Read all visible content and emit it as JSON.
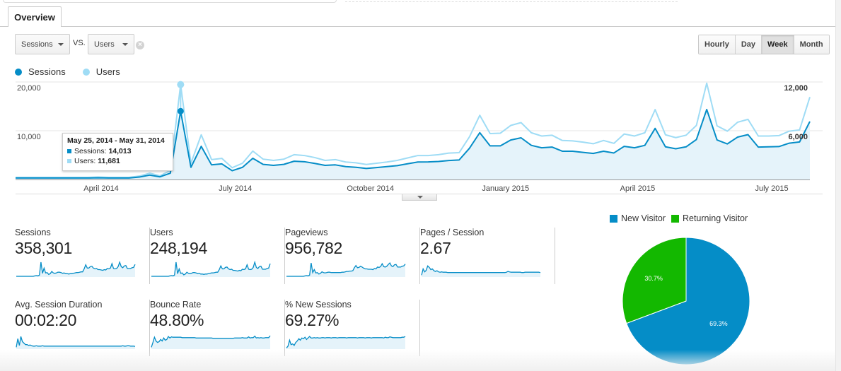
{
  "tabs": [
    {
      "label": "Overview",
      "active": true
    }
  ],
  "controls": {
    "primary_metric": "Sessions",
    "vs_label": "VS.",
    "secondary_metric": "Users",
    "clear_icon": "×",
    "periods": [
      {
        "label": "Hourly",
        "active": false
      },
      {
        "label": "Day",
        "active": false
      },
      {
        "label": "Week",
        "active": true
      },
      {
        "label": "Month",
        "active": false
      }
    ]
  },
  "colors": {
    "sessions": "#058dc7",
    "users": "#9fdcf5",
    "area_fill": "#e5f3fa",
    "new_visitor": "#058dc7",
    "returning_visitor": "#13b800"
  },
  "tooltip": {
    "title": "May 25, 2014 - May 31, 2014",
    "rows": [
      {
        "label": "Sessions: ",
        "value": "14,013"
      },
      {
        "label": "Users: ",
        "value": "11,681"
      }
    ],
    "hover_index": 16
  },
  "chart_data": [
    {
      "type": "line",
      "title": "",
      "granularity": "week",
      "legend": [
        "Sessions",
        "Users"
      ],
      "legend_position": "top-left",
      "x_tick_labels": [
        "April 2014",
        "July 2014",
        "October 2014",
        "January 2015",
        "April 2015",
        "July 2015"
      ],
      "x_tick_week_index": [
        8.3,
        21.3,
        34.4,
        47.5,
        60.3,
        73.3
      ],
      "left_axis": {
        "series": "Sessions",
        "ticks": [
          "20,000",
          "10,000"
        ],
        "range": [
          0,
          20000
        ]
      },
      "right_axis": {
        "series": "Users",
        "ticks": [
          "12,000",
          "6,000"
        ],
        "range": [
          0,
          12000
        ]
      },
      "grid": true,
      "series": [
        {
          "name": "Sessions",
          "axis": "left",
          "values": [
            300,
            300,
            300,
            300,
            300,
            300,
            300,
            300,
            350,
            300,
            300,
            300,
            500,
            900,
            550,
            1300,
            14013,
            2500,
            6800,
            3000,
            3200,
            1800,
            2500,
            4350,
            3100,
            2900,
            3100,
            3750,
            3650,
            3300,
            2900,
            3000,
            2650,
            2500,
            2270,
            2450,
            2650,
            2850,
            3230,
            3580,
            3600,
            3700,
            3900,
            4000,
            6400,
            9600,
            6900,
            6900,
            8100,
            8550,
            7000,
            6500,
            6650,
            5800,
            5800,
            5560,
            5350,
            5800,
            5440,
            6800,
            6500,
            7000,
            10480,
            6700,
            6300,
            6700,
            8200,
            14350,
            8100,
            7300,
            8700,
            9200,
            6650,
            6700,
            6750,
            7450,
            7700,
            11900
          ]
        },
        {
          "name": "Users",
          "axis": "right",
          "values": [
            260,
            260,
            260,
            260,
            260,
            260,
            260,
            260,
            300,
            260,
            260,
            260,
            420,
            780,
            450,
            1100,
            11681,
            2000,
            5500,
            2450,
            2600,
            1450,
            2000,
            3500,
            2500,
            2350,
            2500,
            3050,
            2950,
            2700,
            2350,
            2450,
            2150,
            2050,
            1850,
            2000,
            2150,
            2350,
            2650,
            2950,
            2950,
            3050,
            3250,
            3300,
            5250,
            7900,
            5650,
            5700,
            6650,
            7000,
            5750,
            5350,
            5450,
            4800,
            4750,
            4600,
            4400,
            4800,
            4450,
            5600,
            5350,
            5750,
            8600,
            5500,
            5150,
            5450,
            6650,
            11850,
            6600,
            5950,
            7050,
            7400,
            5350,
            5350,
            5400,
            5950,
            6100,
            10150
          ]
        }
      ]
    },
    {
      "type": "pie",
      "title": "",
      "legend": [
        "New Visitor",
        "Returning Visitor"
      ],
      "legend_position": "top",
      "values": [
        69.3,
        30.7
      ],
      "labels": [
        "69.3%",
        "30.7%"
      ]
    }
  ],
  "metrics": [
    {
      "label": "Sessions",
      "value": "358,301",
      "spark": [
        2,
        2,
        2,
        2,
        2,
        2,
        2,
        2,
        2,
        2,
        2,
        2,
        3,
        4,
        3,
        5,
        40,
        10,
        24,
        11,
        12,
        7,
        9,
        15,
        11,
        10,
        11,
        13,
        13,
        12,
        10,
        11,
        9,
        9,
        8,
        9,
        9,
        10,
        11,
        12,
        12,
        13,
        14,
        14,
        22,
        33,
        24,
        24,
        28,
        29,
        24,
        22,
        23,
        20,
        20,
        19,
        18,
        20,
        19,
        23,
        22,
        24,
        36,
        23,
        22,
        23,
        28,
        40,
        28,
        25,
        30,
        31,
        23,
        23,
        23,
        25,
        26,
        34
      ]
    },
    {
      "label": "Users",
      "value": "248,194",
      "spark": [
        2,
        2,
        2,
        2,
        2,
        2,
        2,
        2,
        2,
        2,
        2,
        2,
        3,
        4,
        3,
        5,
        40,
        9,
        22,
        10,
        11,
        6,
        8,
        13,
        10,
        9,
        10,
        12,
        12,
        11,
        9,
        10,
        8,
        8,
        7,
        8,
        8,
        9,
        10,
        11,
        11,
        12,
        13,
        13,
        20,
        30,
        22,
        22,
        26,
        27,
        22,
        20,
        21,
        18,
        18,
        17,
        16,
        18,
        17,
        21,
        20,
        22,
        33,
        21,
        20,
        21,
        26,
        40,
        26,
        23,
        28,
        29,
        21,
        21,
        21,
        23,
        24,
        36
      ]
    },
    {
      "label": "Pageviews",
      "value": "956,782",
      "spark": [
        2,
        2,
        2,
        2,
        2,
        2,
        2,
        2,
        2,
        2,
        2,
        2,
        3,
        4,
        3,
        5,
        38,
        12,
        20,
        11,
        12,
        8,
        10,
        14,
        12,
        11,
        12,
        13,
        13,
        12,
        12,
        12,
        12,
        12,
        12,
        12,
        13,
        13,
        14,
        15,
        15,
        16,
        16,
        17,
        25,
        31,
        25,
        26,
        29,
        27,
        24,
        22,
        22,
        21,
        21,
        21,
        20,
        23,
        22,
        27,
        26,
        28,
        36,
        28,
        27,
        29,
        34,
        38,
        30,
        28,
        33,
        34,
        27,
        27,
        27,
        29,
        30,
        35
      ]
    },
    {
      "label": "Pages / Session",
      "value": "2.67",
      "spark": [
        5,
        22,
        14,
        18,
        30,
        26,
        20,
        22,
        17,
        15,
        17,
        14,
        13,
        14,
        13,
        13,
        13,
        12,
        12,
        12,
        12,
        12,
        12,
        12,
        12,
        12,
        12,
        12,
        12,
        12,
        12,
        12,
        12,
        12,
        12,
        12,
        12,
        12,
        12,
        12,
        12,
        12,
        12,
        12,
        12,
        12,
        12,
        12,
        12,
        12,
        12,
        12,
        12,
        12,
        12,
        13,
        15,
        14,
        13,
        13,
        13,
        13,
        13,
        13,
        13,
        12,
        12,
        13,
        13,
        13,
        13,
        13,
        13,
        13,
        13,
        13,
        13,
        12
      ]
    },
    {
      "label": "Avg. Session Duration",
      "value": "00:02:20",
      "spark": [
        5,
        28,
        10,
        34,
        20,
        16,
        12,
        12,
        10,
        11,
        9,
        8,
        8,
        9,
        8,
        8,
        8,
        9,
        8,
        8,
        8,
        8,
        8,
        8,
        8,
        8,
        8,
        8,
        8,
        8,
        8,
        8,
        8,
        8,
        8,
        8,
        8,
        8,
        8,
        8,
        8,
        8,
        8,
        8,
        8,
        8,
        8,
        8,
        8,
        8,
        8,
        8,
        8,
        8,
        8,
        8,
        8,
        8,
        8,
        8,
        8,
        8,
        8,
        8,
        8,
        8,
        8,
        8,
        8,
        9,
        8,
        8,
        9,
        9,
        8,
        8,
        8,
        7
      ]
    },
    {
      "label": "Bounce Rate",
      "value": "48.80%",
      "spark": [
        5,
        18,
        32,
        22,
        18,
        20,
        26,
        22,
        30,
        24,
        26,
        34,
        30,
        33,
        32,
        32,
        32,
        32,
        32,
        32,
        31,
        31,
        31,
        31,
        31,
        31,
        31,
        31,
        31,
        30,
        30,
        30,
        30,
        30,
        30,
        30,
        30,
        30,
        30,
        30,
        29,
        29,
        29,
        29,
        29,
        29,
        29,
        29,
        29,
        29,
        29,
        29,
        29,
        29,
        30,
        30,
        30,
        30,
        30,
        31,
        30,
        30,
        30,
        33,
        30,
        31,
        31,
        35,
        30,
        31,
        30,
        31,
        30,
        30,
        31,
        31,
        31,
        36
      ]
    },
    {
      "label": "% New Sessions",
      "value": "69.27%",
      "spark": [
        3,
        8,
        24,
        12,
        14,
        10,
        18,
        22,
        28,
        24,
        30,
        28,
        32,
        26,
        30,
        34,
        30,
        30,
        31,
        30,
        31,
        30,
        30,
        31,
        31,
        30,
        31,
        31,
        31,
        30,
        31,
        31,
        31,
        30,
        31,
        31,
        31,
        31,
        31,
        30,
        31,
        31,
        31,
        31,
        31,
        31,
        30,
        31,
        31,
        31,
        31,
        30,
        31,
        31,
        31,
        30,
        31,
        31,
        31,
        31,
        31,
        31,
        31,
        30,
        32,
        31,
        31,
        33,
        32,
        31,
        31,
        31,
        31,
        31,
        31,
        32,
        32,
        34
      ]
    }
  ]
}
